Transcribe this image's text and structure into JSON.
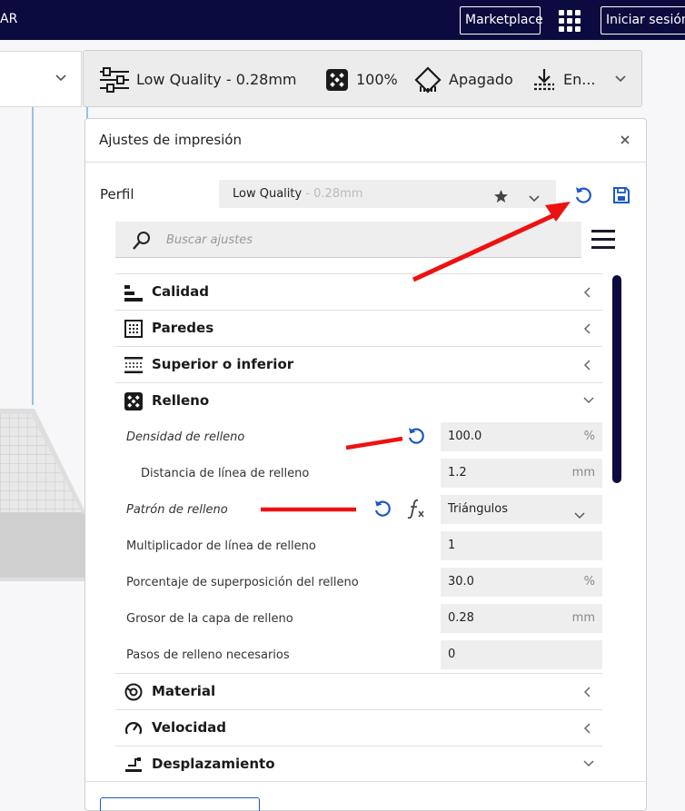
{
  "topbar": {
    "app_name": "AR",
    "marketplace_label": "Marketplace",
    "login_label": "Iniciar sesión"
  },
  "header": {
    "quality_label": "Low Quality - 0.28mm",
    "infill_label": "100%",
    "support_label": "Apagado",
    "adhesion_label": "En..."
  },
  "panel": {
    "title": "Ajustes de impresión",
    "profile_label": "Perfil",
    "profile_name": "Low Quality",
    "profile_suffix": " - 0.28mm",
    "search_placeholder": "Buscar ajustes"
  },
  "categories": {
    "calidad": "Calidad",
    "paredes": "Paredes",
    "superior": "Superior o inferior",
    "relleno": "Relleno",
    "material": "Material",
    "velocidad": "Velocidad",
    "desplazamiento": "Desplazamiento"
  },
  "settings": {
    "densidad": {
      "label": "Densidad de relleno",
      "value": "100.0",
      "unit": "%"
    },
    "distancia": {
      "label": "Distancia de línea de relleno",
      "value": "1.2",
      "unit": "mm"
    },
    "patron": {
      "label": "Patrón de relleno",
      "value": "Triángulos"
    },
    "multiplicador": {
      "label": "Multiplicador de línea de relleno",
      "value": "1"
    },
    "superposicion": {
      "label": "Porcentaje de superposición del relleno",
      "value": "30.0",
      "unit": "%"
    },
    "grosor": {
      "label": "Grosor de la capa de relleno",
      "value": "0.28",
      "unit": "mm"
    },
    "pasos": {
      "label": "Pasos de relleno necesarios",
      "value": "0"
    }
  },
  "colors": {
    "topbar": "#0b0b3f",
    "accent_blue": "#1d57c6",
    "annotation_red": "#ee1111"
  }
}
